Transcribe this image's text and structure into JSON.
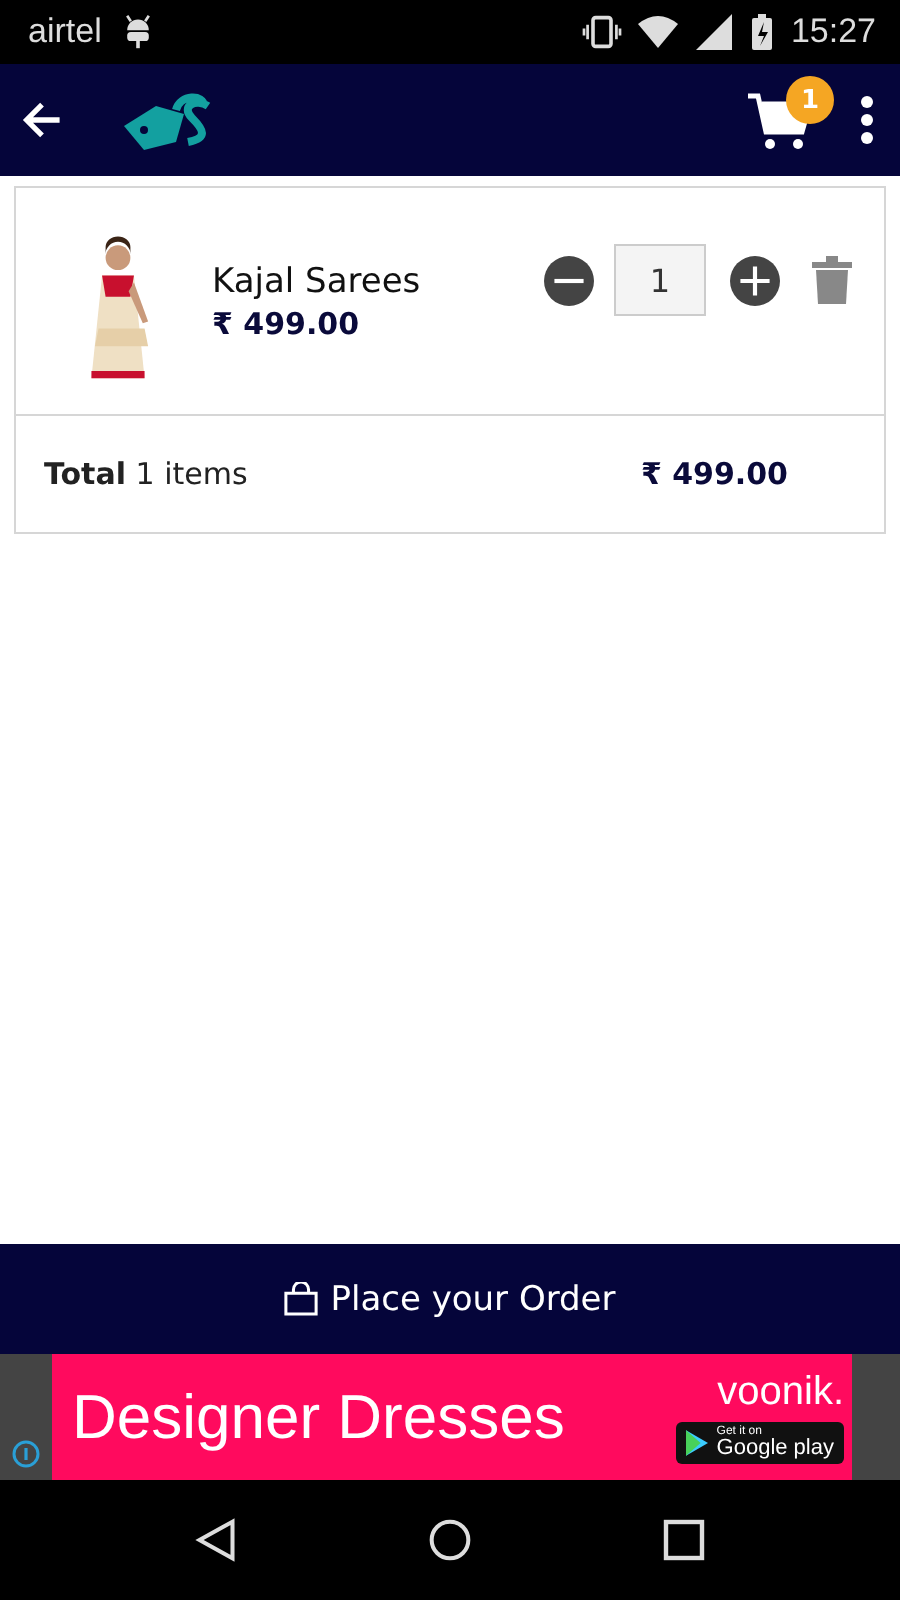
{
  "status_bar": {
    "carrier": "airtel",
    "time": "15:27"
  },
  "app_bar": {
    "cart_count": "1"
  },
  "cart": {
    "items": [
      {
        "name": "Kajal Sarees",
        "price": "₹ 499.00",
        "quantity": "1"
      }
    ],
    "total": {
      "text": "**Total** 1 items",
      "amount": "₹ 499.00"
    }
  },
  "order_button": {
    "label": "Place your Order"
  },
  "ad": {
    "headline": "Designer Dresses",
    "brand": "voonik.",
    "badge_small": "Get it on",
    "badge_large": "Google play"
  }
}
